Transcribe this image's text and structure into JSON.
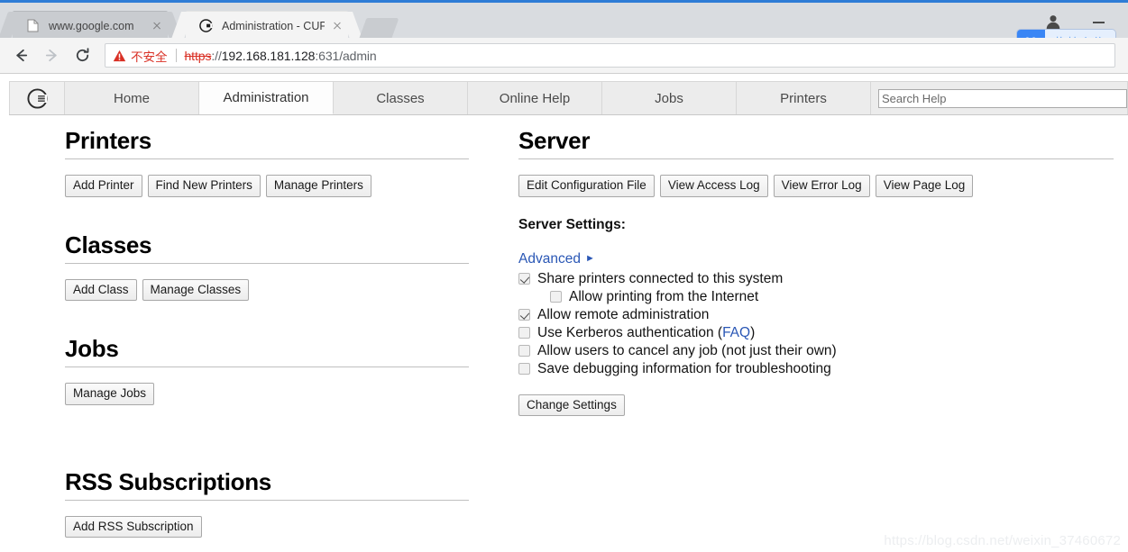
{
  "browser": {
    "tabs": [
      {
        "title": "www.google.com",
        "favicon": "page-icon",
        "active": false
      },
      {
        "title": "Administration - CUPS",
        "favicon": "cups-icon",
        "active": true
      }
    ],
    "new_tab_label": "New Tab",
    "toolbar": {
      "back_label": "Back",
      "forward_label": "Forward",
      "reload_label": "Reload"
    },
    "omnibox": {
      "security_label": "不安全",
      "scheme": "https",
      "separator": "://",
      "host": "192.168.181.128",
      "rest": ":631/admin",
      "full_url": "https://192.168.181.128:631/admin"
    },
    "window": {
      "profile_label": "Profile",
      "minimize_label": "Minimize"
    },
    "extension": {
      "name": "baidu-netdisk",
      "tooltip": "拖拽上传"
    },
    "accent_color": "#2e7cd6"
  },
  "cups": {
    "nav": {
      "logo_alt": "CUPS",
      "tabs": [
        {
          "label": "Home",
          "selected": false
        },
        {
          "label": "Administration",
          "selected": true
        },
        {
          "label": "Classes",
          "selected": false
        },
        {
          "label": "Online Help",
          "selected": false
        },
        {
          "label": "Jobs",
          "selected": false
        },
        {
          "label": "Printers",
          "selected": false
        }
      ],
      "search_placeholder": "Search Help",
      "search_value": ""
    },
    "left": {
      "printers": {
        "heading": "Printers",
        "buttons": [
          "Add Printer",
          "Find New Printers",
          "Manage Printers"
        ]
      },
      "classes": {
        "heading": "Classes",
        "buttons": [
          "Add Class",
          "Manage Classes"
        ]
      },
      "jobs": {
        "heading": "Jobs",
        "buttons": [
          "Manage Jobs"
        ]
      },
      "rss": {
        "heading": "RSS Subscriptions",
        "buttons": [
          "Add RSS Subscription"
        ]
      }
    },
    "right": {
      "server": {
        "heading": "Server",
        "buttons": [
          "Edit Configuration File",
          "View Access Log",
          "View Error Log",
          "View Page Log"
        ],
        "settings_label": "Server Settings:",
        "advanced_label": "Advanced",
        "advanced_arrow": "►",
        "checkboxes": [
          {
            "label": "Share printers connected to this system",
            "checked": true,
            "indent": false
          },
          {
            "label": "Allow printing from the Internet",
            "checked": false,
            "indent": true
          },
          {
            "label": "Allow remote administration",
            "checked": true,
            "indent": false
          },
          {
            "label": "Use Kerberos authentication (",
            "link": "FAQ",
            "label_after": ")",
            "checked": false,
            "indent": false
          },
          {
            "label": "Allow users to cancel any job (not just their own)",
            "checked": false,
            "indent": false
          },
          {
            "label": "Save debugging information for troubleshooting",
            "checked": false,
            "indent": false
          }
        ],
        "change_settings_label": "Change Settings"
      }
    },
    "link_color": "#2a57b5"
  },
  "watermark": "https://blog.csdn.net/weixin_37460672"
}
